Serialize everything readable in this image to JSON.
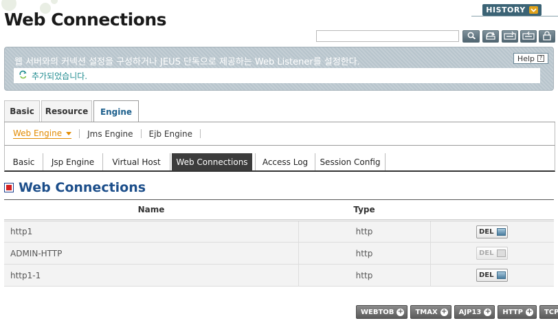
{
  "page": {
    "title": "Web Connections"
  },
  "header": {
    "history_label": "HISTORY"
  },
  "search": {
    "value": "",
    "placeholder": ""
  },
  "info": {
    "description": "웹 서버와의 커넥션 설정을 구성하거나 JEUS 단독으로 제공하는 Web Listener를 설정한다.",
    "help_label": "Help",
    "message": "추가되었습니다."
  },
  "tabs_main": [
    {
      "label": "Basic"
    },
    {
      "label": "Resource"
    },
    {
      "label": "Engine",
      "active": true
    }
  ],
  "sub_nav": [
    {
      "label": "Web Engine",
      "active": true
    },
    {
      "label": "Jms Engine"
    },
    {
      "label": "Ejb Engine"
    }
  ],
  "tabs_sub": [
    {
      "label": "Basic"
    },
    {
      "label": "Jsp Engine"
    },
    {
      "label": "Virtual Host"
    },
    {
      "label": "Web Connections",
      "active": true
    },
    {
      "label": "Access Log"
    },
    {
      "label": "Session Config"
    }
  ],
  "section": {
    "title": "Web Connections"
  },
  "table": {
    "headers": [
      "Name",
      "Type"
    ],
    "rows": [
      {
        "name": "http1",
        "type": "http",
        "action": "DEL",
        "enabled": true
      },
      {
        "name": "ADMIN-HTTP",
        "type": "http",
        "action": "DEL",
        "enabled": false
      },
      {
        "name": "http1-1",
        "type": "http",
        "action": "DEL",
        "enabled": true
      }
    ]
  },
  "add_buttons": [
    "WEBTOB",
    "TMAX",
    "AJP13",
    "HTTP",
    "TCP"
  ],
  "colors": {
    "accent": "#1c4e8a",
    "active_subnav": "#e28a00",
    "history": "#3b6375",
    "message": "#1f8b8f"
  }
}
